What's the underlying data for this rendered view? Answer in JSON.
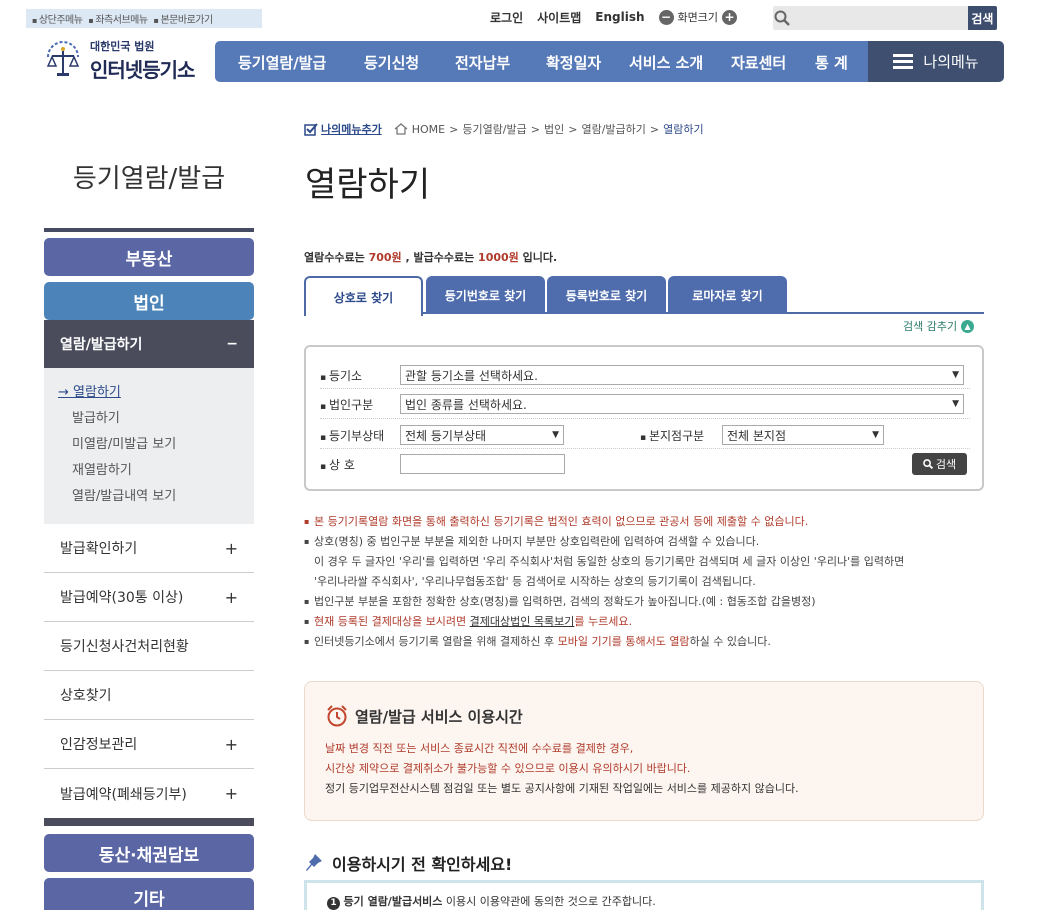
{
  "skip_links": [
    "상단주메뉴",
    "좌측서브메뉴",
    "본문바로가기"
  ],
  "util": {
    "login": "로그인",
    "sitemap": "사이트맵",
    "english": "English",
    "zoom": "화면크기",
    "minus": "−",
    "plus": "+"
  },
  "search": {
    "button": "검색",
    "placeholder": ""
  },
  "logo": {
    "line1": "대한민국 법원",
    "line2": "인터넷등기소"
  },
  "gnb": [
    "등기열람/발급",
    "등기신청",
    "전자납부",
    "확정일자",
    "서비스 소개",
    "자료센터",
    "통 계"
  ],
  "my_menu": "나의메뉴",
  "breadcrumb": {
    "add": "나의메뉴추가",
    "items": [
      "HOME",
      "등기열람/발급",
      "법인",
      "열람/발급하기",
      "열람하기"
    ]
  },
  "side_title": "등기열람/발급",
  "page_title": "열람하기",
  "sidebar": {
    "realestate": "부동산",
    "corporation": "법인",
    "open_group": "열람/발급하기",
    "open_sign": "−",
    "sub": [
      "열람하기",
      "발급하기",
      "미열람/미발급 보기",
      "재열람하기",
      "열람/발급내역 보기"
    ],
    "items": [
      {
        "label": "발급확인하기",
        "sign": "+"
      },
      {
        "label": "발급예약(30통 이상)",
        "sign": "+"
      },
      {
        "label": "등기신청사건처리현황",
        "sign": ""
      },
      {
        "label": "상호찾기",
        "sign": ""
      },
      {
        "label": "인감정보관리",
        "sign": "+"
      },
      {
        "label": "발급예약(폐쇄등기부)",
        "sign": "+"
      }
    ],
    "movable": "동산·채권담보",
    "etc": "기타"
  },
  "fee": {
    "pre": "열람수수료는 ",
    "view_fee": "700원",
    "mid": " , 발급수수료는 ",
    "issue_fee": "1000원",
    "post": " 입니다."
  },
  "tabs": [
    "상호로 찾기",
    "등기번호로 찾기",
    "등록번호로 찾기",
    "로마자로 찾기"
  ],
  "hide_search": "검색 감추기",
  "form": {
    "registry_label": "등기소",
    "registry_value": "관할 등기소를 선택하세요.",
    "corp_type_label": "법인구분",
    "corp_type_value": "법인 종류를 선택하세요.",
    "status_label": "등기부상태",
    "status_value": "전체 등기부상태",
    "branch_label": "본지점구분",
    "branch_value": "전체 본지점",
    "name_label": "상 호",
    "name_value": "",
    "search_button": "검색"
  },
  "notes": {
    "n1": "본 등기기록열람 화면을 통해 출력하신 등기기록은 법적인 효력이 없으므로 관공서 등에 제출할 수 없습니다.",
    "n2a": "상호(명칭) 중 법인구분 부분을 제외한 나머지 부분만 상호입력란에 입력하여 검색할 수 있습니다.",
    "n2b": "이 경우 두 글자인 '우리'를 입력하면 '우리 주식회사'처럼 동일한 상호의 등기기록만 검색되며 세 글자 이상인 '우리나'를 입력하면",
    "n2c": "'우리나라쌀 주식회사', '우리나무협동조합' 등 검색어로 시작하는 상호의 등기기록이 검색됩니다.",
    "n3": "법인구분 부분을 포함한 정확한 상호(명칭)를 입력하면, 검색의 정확도가 높아집니다.(예 : 협동조합 갑을병정)",
    "n4a": "현재 등록된 결제대상을 보시려면 ",
    "n4link": "결제대상법인 목록보기",
    "n4b": "를 누르세요.",
    "n5a": "인터넷등기소에서 등기기록 열람을 위해 결제하신 후 ",
    "n5red": "모바일 기기를 통해서도 열람",
    "n5b": "하실 수 있습니다."
  },
  "service": {
    "title": "열람/발급 서비스 이용시간",
    "l1": "날짜 변경 직전 또는 서비스 종료시간 직전에 수수료를 결제한 경우,",
    "l2": "시간상 제약으로 결제취소가 불가능할 수 있으므로 이용시 유의하시기 바랍니다.",
    "l3": "정기 등기업무전산시스템 점검일 또는 별도 공지사항에 기재된 작업일에는 서비스를 제공하지 않습니다."
  },
  "check": {
    "title": "이용하시기 전 확인하세요!",
    "num": "1",
    "bold": "등기 열람/발급서비스",
    "rest": " 이용시 이용약관에 동의한 것으로 간주합니다."
  },
  "colors": {
    "gnb": "#5679b7",
    "dark": "#3e4f70",
    "accent_red": "#b03b2b",
    "sidebar_purple": "#5b66a4",
    "sidebar_blue": "#4c84b9"
  }
}
